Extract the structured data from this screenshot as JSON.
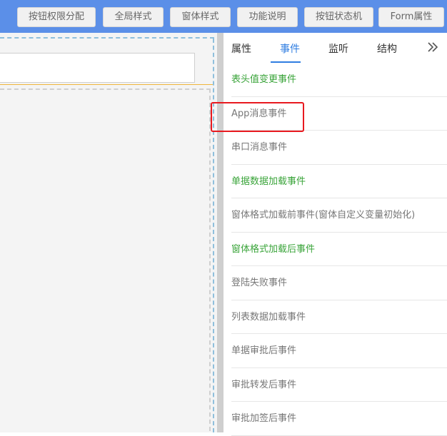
{
  "toolbar": {
    "buttons": [
      {
        "label": "按钮权限分配"
      },
      {
        "label": "全局样式"
      },
      {
        "label": "窗体样式"
      },
      {
        "label": "功能说明"
      },
      {
        "label": "按钮状态机"
      },
      {
        "label": "Form属性"
      }
    ]
  },
  "panel": {
    "tabs": [
      {
        "label": "属性",
        "active": false
      },
      {
        "label": "事件",
        "active": true
      },
      {
        "label": "监听",
        "active": false
      },
      {
        "label": "结构",
        "active": false
      }
    ],
    "more_icon": "double-chevron-right-icon",
    "events": [
      {
        "label": "表头值变更事件",
        "status": "defined"
      },
      {
        "label": "App消息事件",
        "status": "undefined",
        "highlighted": true
      },
      {
        "label": "串口消息事件",
        "status": "undefined"
      },
      {
        "label": "单据数据加载事件",
        "status": "defined"
      },
      {
        "label": "窗体格式加载前事件(窗体自定义变量初始化)",
        "status": "undefined"
      },
      {
        "label": "窗体格式加载后事件",
        "status": "defined"
      },
      {
        "label": "登陆失败事件",
        "status": "undefined"
      },
      {
        "label": "列表数据加载事件",
        "status": "undefined"
      },
      {
        "label": "单据审批后事件",
        "status": "undefined"
      },
      {
        "label": "审批转发后事件",
        "status": "undefined"
      },
      {
        "label": "审批加签后事件",
        "status": "undefined"
      }
    ]
  },
  "colors": {
    "toolbar_bg": "#5b8fe8",
    "accent": "#2f7de1",
    "defined_event": "#3aa43a",
    "undefined_event": "#777777",
    "highlight": "#e8191f"
  }
}
